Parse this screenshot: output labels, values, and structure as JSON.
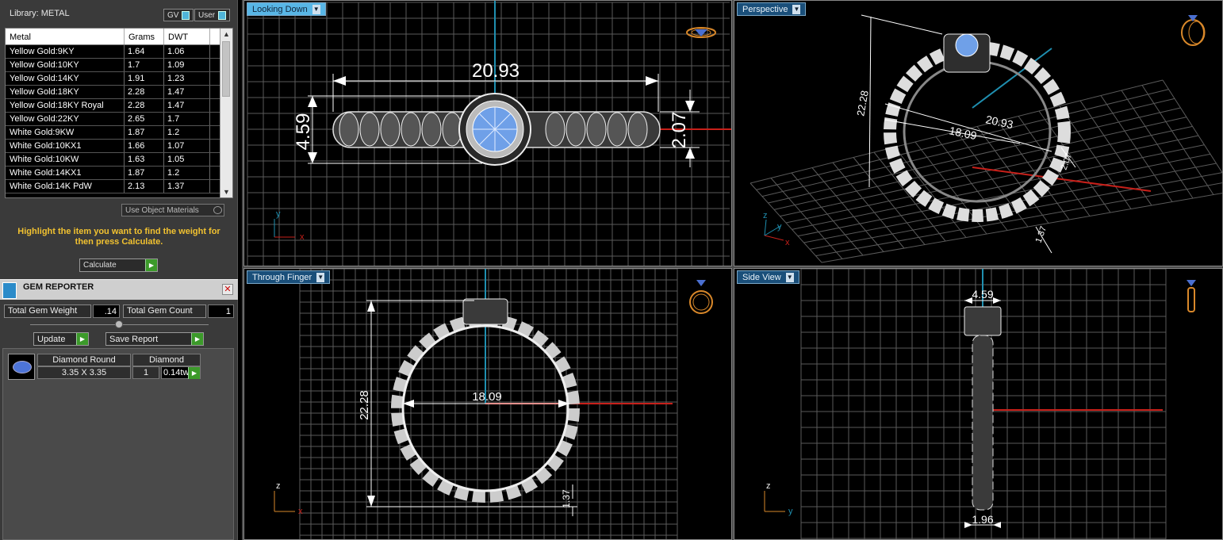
{
  "library": {
    "title": "Library: METAL",
    "toggle_gv": "GV",
    "toggle_user": "User",
    "columns": [
      "Metal",
      "Grams",
      "DWT"
    ],
    "rows": [
      [
        "Yellow Gold:9KY",
        "1.64",
        "1.06"
      ],
      [
        "Yellow Gold:10KY",
        "1.7",
        "1.09"
      ],
      [
        "Yellow Gold:14KY",
        "1.91",
        "1.23"
      ],
      [
        "Yellow Gold:18KY",
        "2.28",
        "1.47"
      ],
      [
        "Yellow Gold:18KY Royal",
        "2.28",
        "1.47"
      ],
      [
        "Yellow Gold:22KY",
        "2.65",
        "1.7"
      ],
      [
        "White Gold:9KW",
        "1.87",
        "1.2"
      ],
      [
        "White Gold:10KX1",
        "1.66",
        "1.07"
      ],
      [
        "White Gold:10KW",
        "1.63",
        "1.05"
      ],
      [
        "White Gold:14KX1",
        "1.87",
        "1.2"
      ],
      [
        "White Gold:14K PdW",
        "2.13",
        "1.37"
      ]
    ],
    "use_object_materials": "Use Object Materials",
    "hint": "Highlight the item you want to find the weight for then press Calculate.",
    "calculate": "Calculate"
  },
  "gem_reporter": {
    "title": "GEM REPORTER",
    "total_weight_label": "Total Gem Weight",
    "total_weight_value": ".14",
    "total_count_label": "Total Gem Count",
    "total_count_value": "1",
    "update": "Update",
    "save_report": "Save Report",
    "item": {
      "shape": "Diamond Round",
      "size": "3.35 X 3.35",
      "material": "Diamond",
      "count": "1",
      "weight": "0.14tw"
    }
  },
  "viewports": {
    "top_left": {
      "label": "Looking Down",
      "dims": {
        "length": "20.93",
        "height_left": "4.59",
        "height_right": "2.07"
      },
      "axes": {
        "a": "y",
        "b": "x"
      }
    },
    "top_right": {
      "label": "Perspective",
      "dims": {
        "outer": "20.93",
        "inner": "18.09",
        "height": "22.28",
        "band": "2.07",
        "bottom": "1.37"
      },
      "axes": {
        "a": "z",
        "b": "y",
        "c": "x"
      }
    },
    "bottom_left": {
      "label": "Through Finger",
      "dims": {
        "diameter": "18.09",
        "height": "22.28",
        "band": "1.37"
      },
      "axes": {
        "a": "z",
        "b": "x"
      }
    },
    "bottom_right": {
      "label": "Side View",
      "dims": {
        "top": "4.59",
        "bottom": "1.96"
      },
      "axes": {
        "a": "z",
        "b": "y"
      }
    }
  },
  "colors": {
    "grid": "#5a5a5a",
    "axis_red": "#c8201a",
    "axis_blue": "#1f8fb0",
    "gem_blue": "#6fa0e8",
    "tab_bg": "#1a4f7a",
    "hint_yellow": "#f2c230",
    "ring_icon": "#d9882a"
  }
}
